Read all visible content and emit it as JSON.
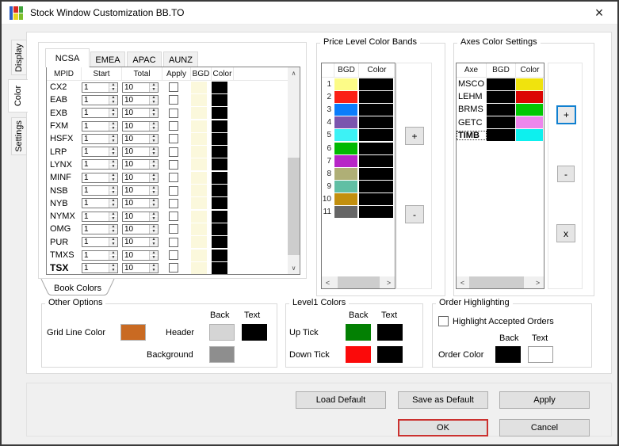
{
  "window": {
    "title": "Stock Window Customization BB.TO",
    "close_glyph": "×"
  },
  "app_icon_colors": {
    "bar": "#2C5FC4",
    "tl": "#D8281E",
    "tr": "#3FA33C",
    "bl": "#E8D51F",
    "br": "#7CBF2C"
  },
  "side_tabs": [
    {
      "label": "Display",
      "selected": false
    },
    {
      "label": "Color",
      "selected": true
    },
    {
      "label": "Settings",
      "selected": false
    }
  ],
  "book_tabs": [
    {
      "label": "NCSA",
      "selected": true
    },
    {
      "label": "EMEA",
      "selected": false
    },
    {
      "label": "APAC",
      "selected": false
    },
    {
      "label": "AUNZ",
      "selected": false
    }
  ],
  "book_colors_tab": "Book Colors",
  "mpid_table": {
    "headers": [
      "MPID",
      "Start",
      "Total",
      "Apply",
      "BGD",
      "Color"
    ],
    "rows": [
      {
        "mpid": "CX2",
        "start": "1",
        "total": "10",
        "applied": false,
        "bgd": "#FBF8DC",
        "color": "#000000",
        "bold": false
      },
      {
        "mpid": "EAB",
        "start": "1",
        "total": "10",
        "applied": false,
        "bgd": "#FBF8DC",
        "color": "#000000",
        "bold": false
      },
      {
        "mpid": "EXB",
        "start": "1",
        "total": "10",
        "applied": false,
        "bgd": "#FBF8DC",
        "color": "#000000",
        "bold": false
      },
      {
        "mpid": "FXM",
        "start": "1",
        "total": "10",
        "applied": false,
        "bgd": "#FBF8DC",
        "color": "#000000",
        "bold": false
      },
      {
        "mpid": "HSFX",
        "start": "1",
        "total": "10",
        "applied": false,
        "bgd": "#FBF8DC",
        "color": "#000000",
        "bold": false
      },
      {
        "mpid": "LRP",
        "start": "1",
        "total": "10",
        "applied": false,
        "bgd": "#FBF8DC",
        "color": "#000000",
        "bold": false
      },
      {
        "mpid": "LYNX",
        "start": "1",
        "total": "10",
        "applied": false,
        "bgd": "#FBF8DC",
        "color": "#000000",
        "bold": false
      },
      {
        "mpid": "MINF",
        "start": "1",
        "total": "10",
        "applied": false,
        "bgd": "#FBF8DC",
        "color": "#000000",
        "bold": false
      },
      {
        "mpid": "NSB",
        "start": "1",
        "total": "10",
        "applied": false,
        "bgd": "#FBF8DC",
        "color": "#000000",
        "bold": false
      },
      {
        "mpid": "NYB",
        "start": "1",
        "total": "10",
        "applied": false,
        "bgd": "#FBF8DC",
        "color": "#000000",
        "bold": false
      },
      {
        "mpid": "NYMX",
        "start": "1",
        "total": "10",
        "applied": false,
        "bgd": "#FBF8DC",
        "color": "#000000",
        "bold": false
      },
      {
        "mpid": "OMG",
        "start": "1",
        "total": "10",
        "applied": false,
        "bgd": "#FBF8DC",
        "color": "#000000",
        "bold": false
      },
      {
        "mpid": "PUR",
        "start": "1",
        "total": "10",
        "applied": false,
        "bgd": "#FBF8DC",
        "color": "#000000",
        "bold": false
      },
      {
        "mpid": "TMXS",
        "start": "1",
        "total": "10",
        "applied": false,
        "bgd": "#FBF8DC",
        "color": "#000000",
        "bold": false
      },
      {
        "mpid": "TSX",
        "start": "1",
        "total": "10",
        "applied": false,
        "bgd": "#FBF8DC",
        "color": "#000000",
        "bold": true
      }
    ]
  },
  "price_bands": {
    "title": "Price Level Color Bands",
    "headers": [
      "BGD",
      "Color"
    ],
    "rows": [
      {
        "n": "1",
        "bgd": "#FCFB87",
        "color": "#000000"
      },
      {
        "n": "2",
        "bgd": "#FB2015",
        "color": "#000000"
      },
      {
        "n": "3",
        "bgd": "#0B7DFB",
        "color": "#000000"
      },
      {
        "n": "4",
        "bgd": "#7B55AE",
        "color": "#000000"
      },
      {
        "n": "5",
        "bgd": "#3DF2F5",
        "color": "#000000"
      },
      {
        "n": "6",
        "bgd": "#02B902",
        "color": "#000000"
      },
      {
        "n": "7",
        "bgd": "#B726C7",
        "color": "#000000"
      },
      {
        "n": "8",
        "bgd": "#AFAF76",
        "color": "#000000"
      },
      {
        "n": "9",
        "bgd": "#61BFA4",
        "color": "#000000"
      },
      {
        "n": "10",
        "bgd": "#C28F0E",
        "color": "#000000"
      },
      {
        "n": "11",
        "bgd": "#666666",
        "color": "#000000"
      }
    ],
    "add_label": "+",
    "remove_label": "-"
  },
  "axes": {
    "title": "Axes Color Settings",
    "headers": [
      "Axe",
      "BGD",
      "Color"
    ],
    "rows": [
      {
        "axe": "MSCO",
        "bgd": "#000000",
        "color": "#F0E30D",
        "bold": false,
        "focused": false
      },
      {
        "axe": "LEHM",
        "bgd": "#000000",
        "color": "#DC0503",
        "bold": false,
        "focused": false
      },
      {
        "axe": "BRMS",
        "bgd": "#000000",
        "color": "#02C702",
        "bold": false,
        "focused": false
      },
      {
        "axe": "GETC",
        "bgd": "#000000",
        "color": "#ED86EC",
        "bold": false,
        "focused": false
      },
      {
        "axe": "TIMB",
        "bgd": "#000000",
        "color": "#0DF0EE",
        "bold": true,
        "focused": true
      }
    ],
    "add_label": "+",
    "remove_label": "-",
    "delete_label": "x"
  },
  "other_options": {
    "title": "Other Options",
    "back_header": "Back",
    "text_header": "Text",
    "grid_line_label": "Grid Line Color",
    "grid_line_color": "#C96A22",
    "header_label": "Header",
    "header_back": "#D5D5D5",
    "header_text": "#000000",
    "background_label": "Background",
    "background_color": "#8E8E8E"
  },
  "level1": {
    "title": "Level1 Colors",
    "back_header": "Back",
    "text_header": "Text",
    "rows": [
      {
        "label": "Up Tick",
        "back": "#038003",
        "text": "#000000"
      },
      {
        "label": "Down Tick",
        "back": "#FB0A0A",
        "text": "#000000"
      }
    ]
  },
  "order_highlighting": {
    "title": "Order Highlighting",
    "checkbox_label": "Highlight Accepted Orders",
    "checked": false,
    "back_header": "Back",
    "text_header": "Text",
    "order_color_label": "Order Color",
    "back": "#000000",
    "text": "#FFFFFF"
  },
  "action_buttons": {
    "load_default": "Load Default",
    "save_as_default": "Save as Default",
    "apply": "Apply",
    "ok": "OK",
    "cancel": "Cancel"
  },
  "glyphs": {
    "spin_up": "▲",
    "spin_down": "▼",
    "scroll_up": "∧",
    "scroll_down": "∨",
    "scroll_left": "<",
    "scroll_right": ">"
  },
  "accent": {
    "focus_border": "#1080D0",
    "ok_border": "#CB312F"
  }
}
